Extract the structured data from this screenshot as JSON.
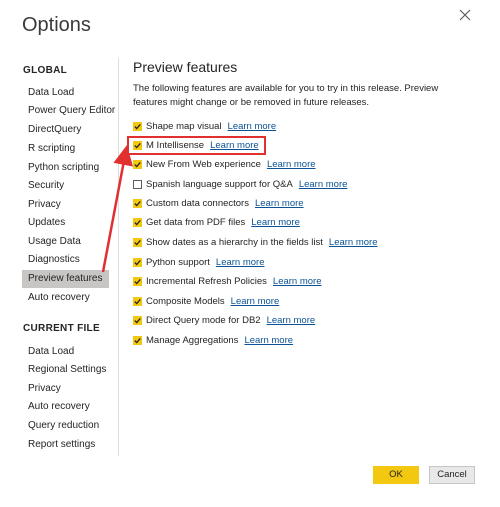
{
  "dialog": {
    "title": "Options"
  },
  "nav": {
    "global_header": "GLOBAL",
    "global_items": [
      {
        "label": "Data Load"
      },
      {
        "label": "Power Query Editor"
      },
      {
        "label": "DirectQuery"
      },
      {
        "label": "R scripting"
      },
      {
        "label": "Python scripting"
      },
      {
        "label": "Security"
      },
      {
        "label": "Privacy"
      },
      {
        "label": "Updates"
      },
      {
        "label": "Usage Data"
      },
      {
        "label": "Diagnostics"
      },
      {
        "label": "Preview features",
        "selected": true
      },
      {
        "label": "Auto recovery"
      }
    ],
    "current_header": "CURRENT FILE",
    "current_items": [
      {
        "label": "Data Load"
      },
      {
        "label": "Regional Settings"
      },
      {
        "label": "Privacy"
      },
      {
        "label": "Auto recovery"
      },
      {
        "label": "Query reduction"
      },
      {
        "label": "Report settings"
      }
    ]
  },
  "main": {
    "title": "Preview features",
    "description": "The following features are available for you to try in this release. Preview features might change or be removed in future releases.",
    "learn_more": "Learn more",
    "features": [
      {
        "label": "Shape map visual",
        "checked": true
      },
      {
        "label": "M Intellisense",
        "checked": true,
        "highlighted": true
      },
      {
        "label": "New From Web experience",
        "checked": true
      },
      {
        "label": "Spanish language support for Q&A",
        "checked": false
      },
      {
        "label": "Custom data connectors",
        "checked": true
      },
      {
        "label": "Get data from PDF files",
        "checked": true
      },
      {
        "label": "Show dates as a hierarchy in the fields list",
        "checked": true
      },
      {
        "label": "Python support",
        "checked": true
      },
      {
        "label": "Incremental Refresh Policies",
        "checked": true
      },
      {
        "label": "Composite Models",
        "checked": true
      },
      {
        "label": "Direct Query mode for DB2",
        "checked": true
      },
      {
        "label": "Manage Aggregations",
        "checked": true
      }
    ]
  },
  "footer": {
    "ok_label": "OK",
    "cancel_label": "Cancel"
  },
  "colors": {
    "accent": "#f2c811",
    "highlight": "#e03030",
    "link": "#0b5394",
    "selected_nav": "#c8c6c4"
  }
}
